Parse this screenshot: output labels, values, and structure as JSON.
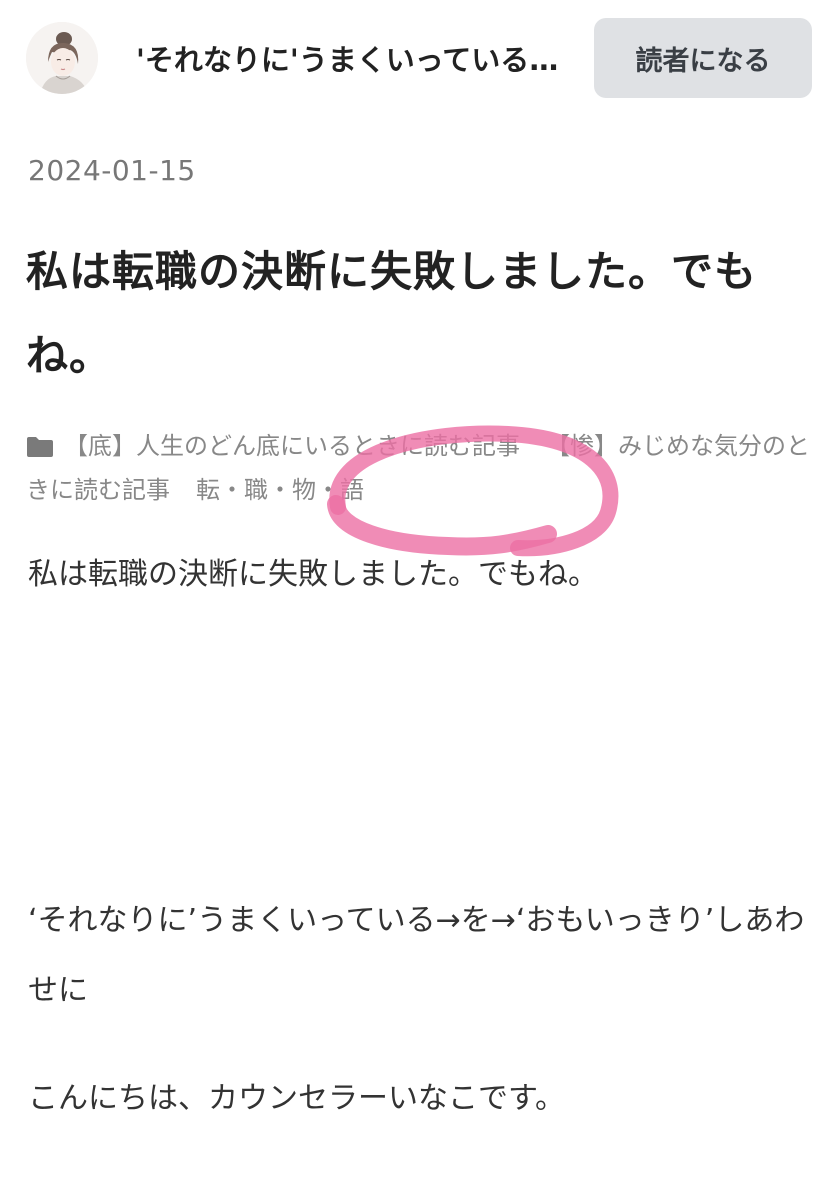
{
  "header": {
    "blog_title": "'それなりに'うまくいっている→を→'おもいっきり'しあわせに",
    "subscribe_label": "読者になる"
  },
  "post": {
    "date": "2024-01-15",
    "title": "私は転職の決断に失敗しました。でもね。",
    "categories": [
      "【底】人生のどん底にいるときに読む記事",
      "【惨】みじめな気分のときに読む記事",
      "転・職・物・語"
    ],
    "paragraphs": [
      "私は転職の決断に失敗しました。でもね。",
      "‘それなりに’うまくいっている→を→‘おもいっきり’しあわせに",
      "こんにちは、カウンセラーいなこです。"
    ]
  },
  "annotation": {
    "highlight_color": "#ec6fa4"
  },
  "icons": {
    "avatar": "avatar-illustration",
    "category": "folder-icon"
  }
}
